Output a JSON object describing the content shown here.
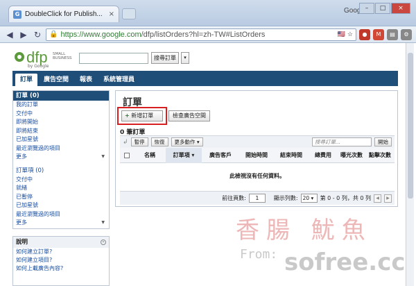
{
  "browser": {
    "tab_title": "DoubleClick for Publish...",
    "tab_close": "×",
    "google_label": "Google",
    "url_host": "https://www.google.com",
    "url_path": "/dfp/listOrders?hl=zh-TW#ListOrders",
    "win_min": "–",
    "win_max": "□",
    "win_close": "×"
  },
  "header": {
    "logo_text": "dfp",
    "logo_small": "SMALL BUSINESS",
    "logo_by": "by Google",
    "search_button": "搜尋訂單",
    "search_dropdown": "▾"
  },
  "nav": {
    "tabs": [
      "訂單",
      "廣告空間",
      "報表",
      "系統管理員"
    ]
  },
  "sidebar": {
    "section1_title": "訂單 (0)",
    "section1_items": [
      "我的訂單",
      "交付中",
      "即將開始",
      "即將結束",
      "已加星號",
      "最近瀏覽過的項目"
    ],
    "section1_more": "更多",
    "section2_title": "訂單項 (0)",
    "section2_items": [
      "交付中",
      "就緒",
      "已暫停",
      "已加星號",
      "最近瀏覽過的項目"
    ],
    "section2_more": "更多"
  },
  "help": {
    "title": "說明",
    "collapse_icon": "⊖",
    "links": [
      "如何建立訂單?",
      "如何建立項目?",
      "如何上載廣告內容?"
    ]
  },
  "main": {
    "title": "訂單",
    "new_order_button": "新增訂單",
    "inventory_button": "檢查廣告空間",
    "count_label": "0 筆訂單",
    "pause_button": "暫停",
    "resume_button": "恢復",
    "more_actions_button": "更多動作 ▾",
    "filter_placeholder": "搜尋訂單...",
    "filter_button": "開始",
    "columns": [
      "名稱",
      "訂單項 ▾",
      "廣告客戶",
      "開始時間",
      "結束時間",
      "總費用",
      "曝光次數",
      "點擊次數"
    ],
    "empty_message": "此檢視沒有任何資料。",
    "pager_goto_label": "前往頁數:",
    "pager_goto_value": "1",
    "pager_rows_label": "顯示列數:",
    "pager_rows_value": "20 ▾",
    "pager_range": "第 0 - 0 列，共 0 列"
  },
  "watermark": {
    "chinese": "香腸  魷魚",
    "from": "From:",
    "site": "sofree.cc"
  }
}
